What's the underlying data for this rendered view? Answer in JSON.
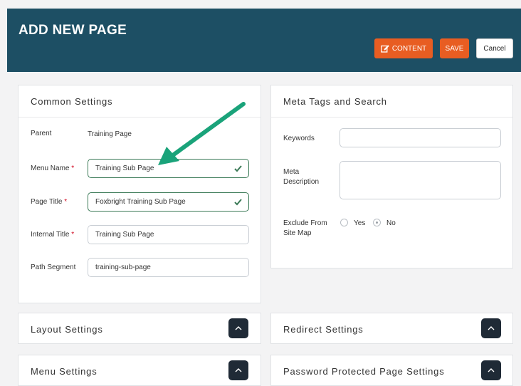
{
  "header": {
    "title": "ADD NEW PAGE",
    "content_label": "CONTENT",
    "save_label": "SAVE",
    "cancel_label": "Cancel"
  },
  "common": {
    "title": "Common Settings",
    "parent_label": "Parent",
    "parent_value": "Training Page",
    "menu_name_label": "Menu Name",
    "menu_name_value": "Training Sub Page",
    "page_title_label": "Page Title",
    "page_title_value": "Foxbright Training Sub Page",
    "internal_title_label": "Internal Title",
    "internal_title_value": "Training Sub Page",
    "path_segment_label": "Path Segment",
    "path_segment_value": "training-sub-page",
    "required_mark": "*"
  },
  "meta": {
    "title": "Meta Tags and Search",
    "keywords_label": "Keywords",
    "keywords_value": "",
    "meta_desc_label_1": "Meta",
    "meta_desc_label_2": "Description",
    "meta_desc_value": "",
    "exclude_label_1": "Exclude From",
    "exclude_label_2": "Site Map",
    "yes_label": "Yes",
    "no_label": "No",
    "selected": "No"
  },
  "sections": {
    "layout": "Layout Settings",
    "redirect": "Redirect Settings",
    "menu": "Menu Settings",
    "password": "Password Protected Page Settings"
  },
  "colors": {
    "header_bg": "#1d4f64",
    "accent_orange": "#e85d22",
    "valid_green": "#3b7a57",
    "arrow_teal": "#1aa37a"
  }
}
